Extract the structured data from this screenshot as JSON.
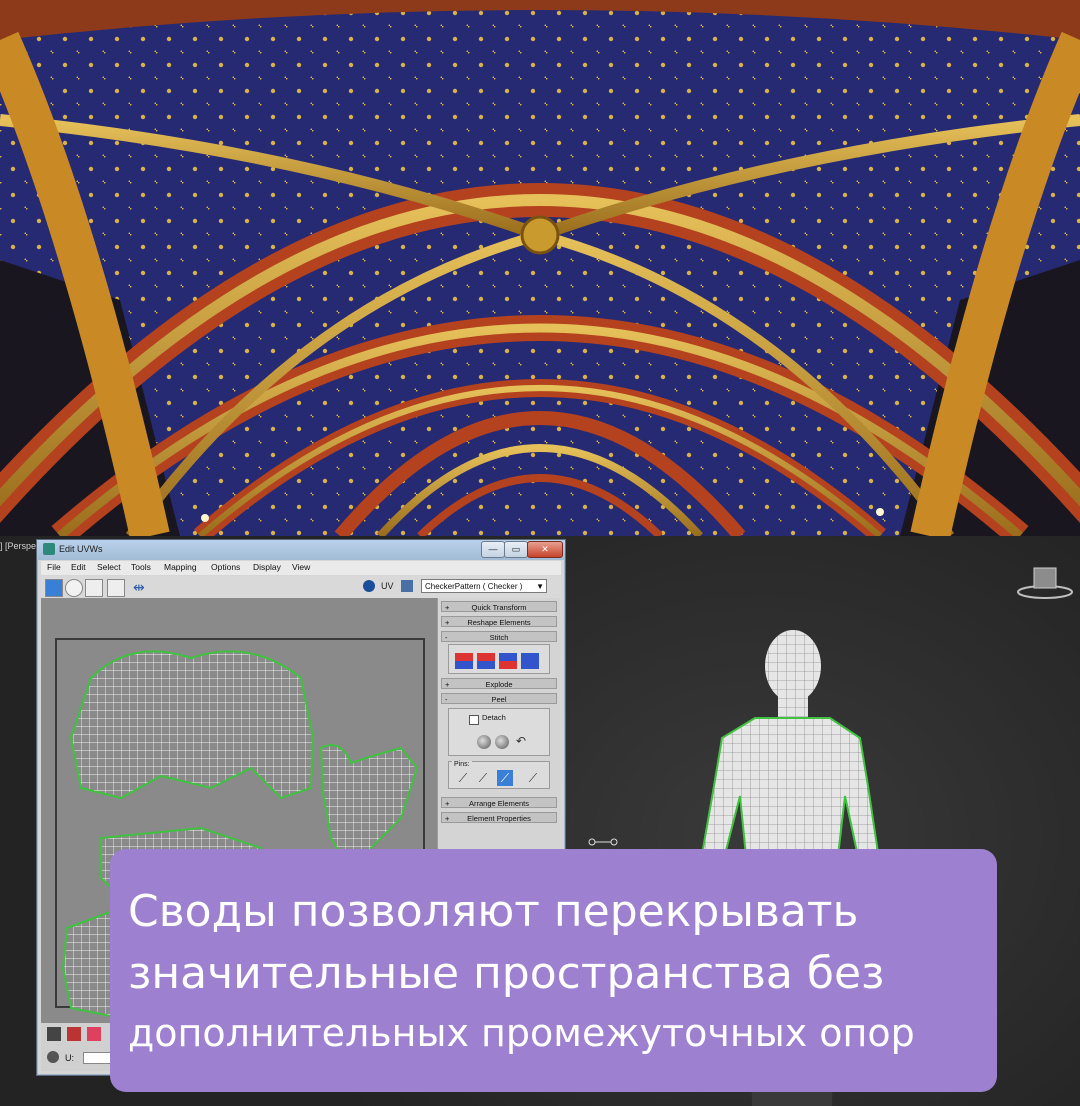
{
  "viewport": {
    "label": "] [Perspe"
  },
  "window": {
    "title": "Edit UVWs",
    "buttons": {
      "minimize": "—",
      "maximize": "▭",
      "close": "✕"
    },
    "menu": [
      "File",
      "Edit",
      "Select",
      "Tools",
      "Mapping",
      "Options",
      "Display",
      "View"
    ],
    "toolbar": {
      "uv_label": "UV",
      "checker_value": "CheckerPattern  ( Checker )"
    },
    "rollouts": {
      "quick_transform": "Quick Transform",
      "reshape_elements": "Reshape Elements",
      "stitch": "Stitch",
      "explode": "Explode",
      "peel": "Peel",
      "detach": "Detach",
      "pins": "Pins:",
      "arrange_elements": "Arrange Elements",
      "element_properties": "Element Properties"
    },
    "bottom": {
      "u_label": "U:"
    }
  },
  "caption": {
    "line1": "Своды позволяют перекрывать",
    "line2": "значительные пространства без",
    "line3": "дополнительных промежуточных опор"
  },
  "icons": [
    "move-icon",
    "rotate-icon",
    "scale-icon",
    "freeform-icon",
    "mirror-icon",
    "uv-icon",
    "checker-icon",
    "viewcube-icon"
  ],
  "colors": {
    "caption_bg": "#9d81d0",
    "uv_seam": "#3fc23f",
    "vault_blue": "#2b2f7e",
    "vault_gold": "#c99a2e",
    "vault_red": "#b4421f"
  }
}
